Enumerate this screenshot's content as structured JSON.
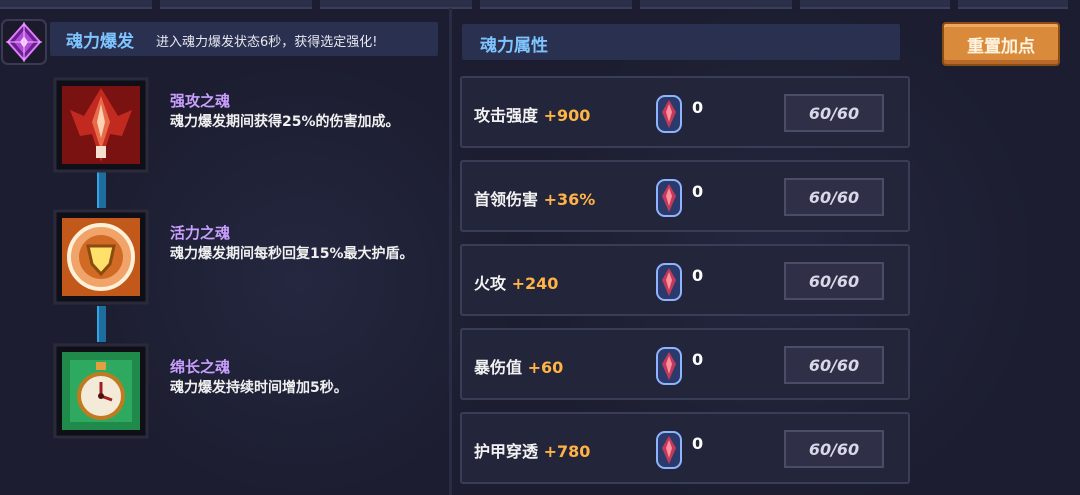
{
  "left": {
    "title": "魂力爆发",
    "description": "进入魂力爆发状态6秒，获得选定强化!"
  },
  "souls": [
    {
      "name": "强攻之魂",
      "description": "魂力爆发期间获得25%的伤害加成。",
      "icon": "red-sword-crest-icon"
    },
    {
      "name": "活力之魂",
      "description": "魂力爆发期间每秒回复15%最大护盾。",
      "icon": "orange-shield-crest-icon"
    },
    {
      "name": "绵长之魂",
      "description": "魂力爆发持续时间增加5秒。",
      "icon": "green-clock-crest-icon"
    }
  ],
  "right": {
    "title": "魂力属性",
    "reset_label": "重置加点"
  },
  "attributes": [
    {
      "name": "攻击强度",
      "bonus": "+900",
      "gems": "0",
      "level": "60/60"
    },
    {
      "name": "首领伤害",
      "bonus": "+36%",
      "gems": "0",
      "level": "60/60"
    },
    {
      "name": "火攻",
      "bonus": "+240",
      "gems": "0",
      "level": "60/60"
    },
    {
      "name": "暴伤值",
      "bonus": "+60",
      "gems": "0",
      "level": "60/60"
    },
    {
      "name": "护甲穿透",
      "bonus": "+780",
      "gems": "0",
      "level": "60/60"
    }
  ],
  "colors": {
    "accent_blue": "#7ec4ff",
    "soul_name_purple": "#c9a0ff",
    "bonus_orange": "#ffb347",
    "button_orange": "#d98a3b"
  }
}
